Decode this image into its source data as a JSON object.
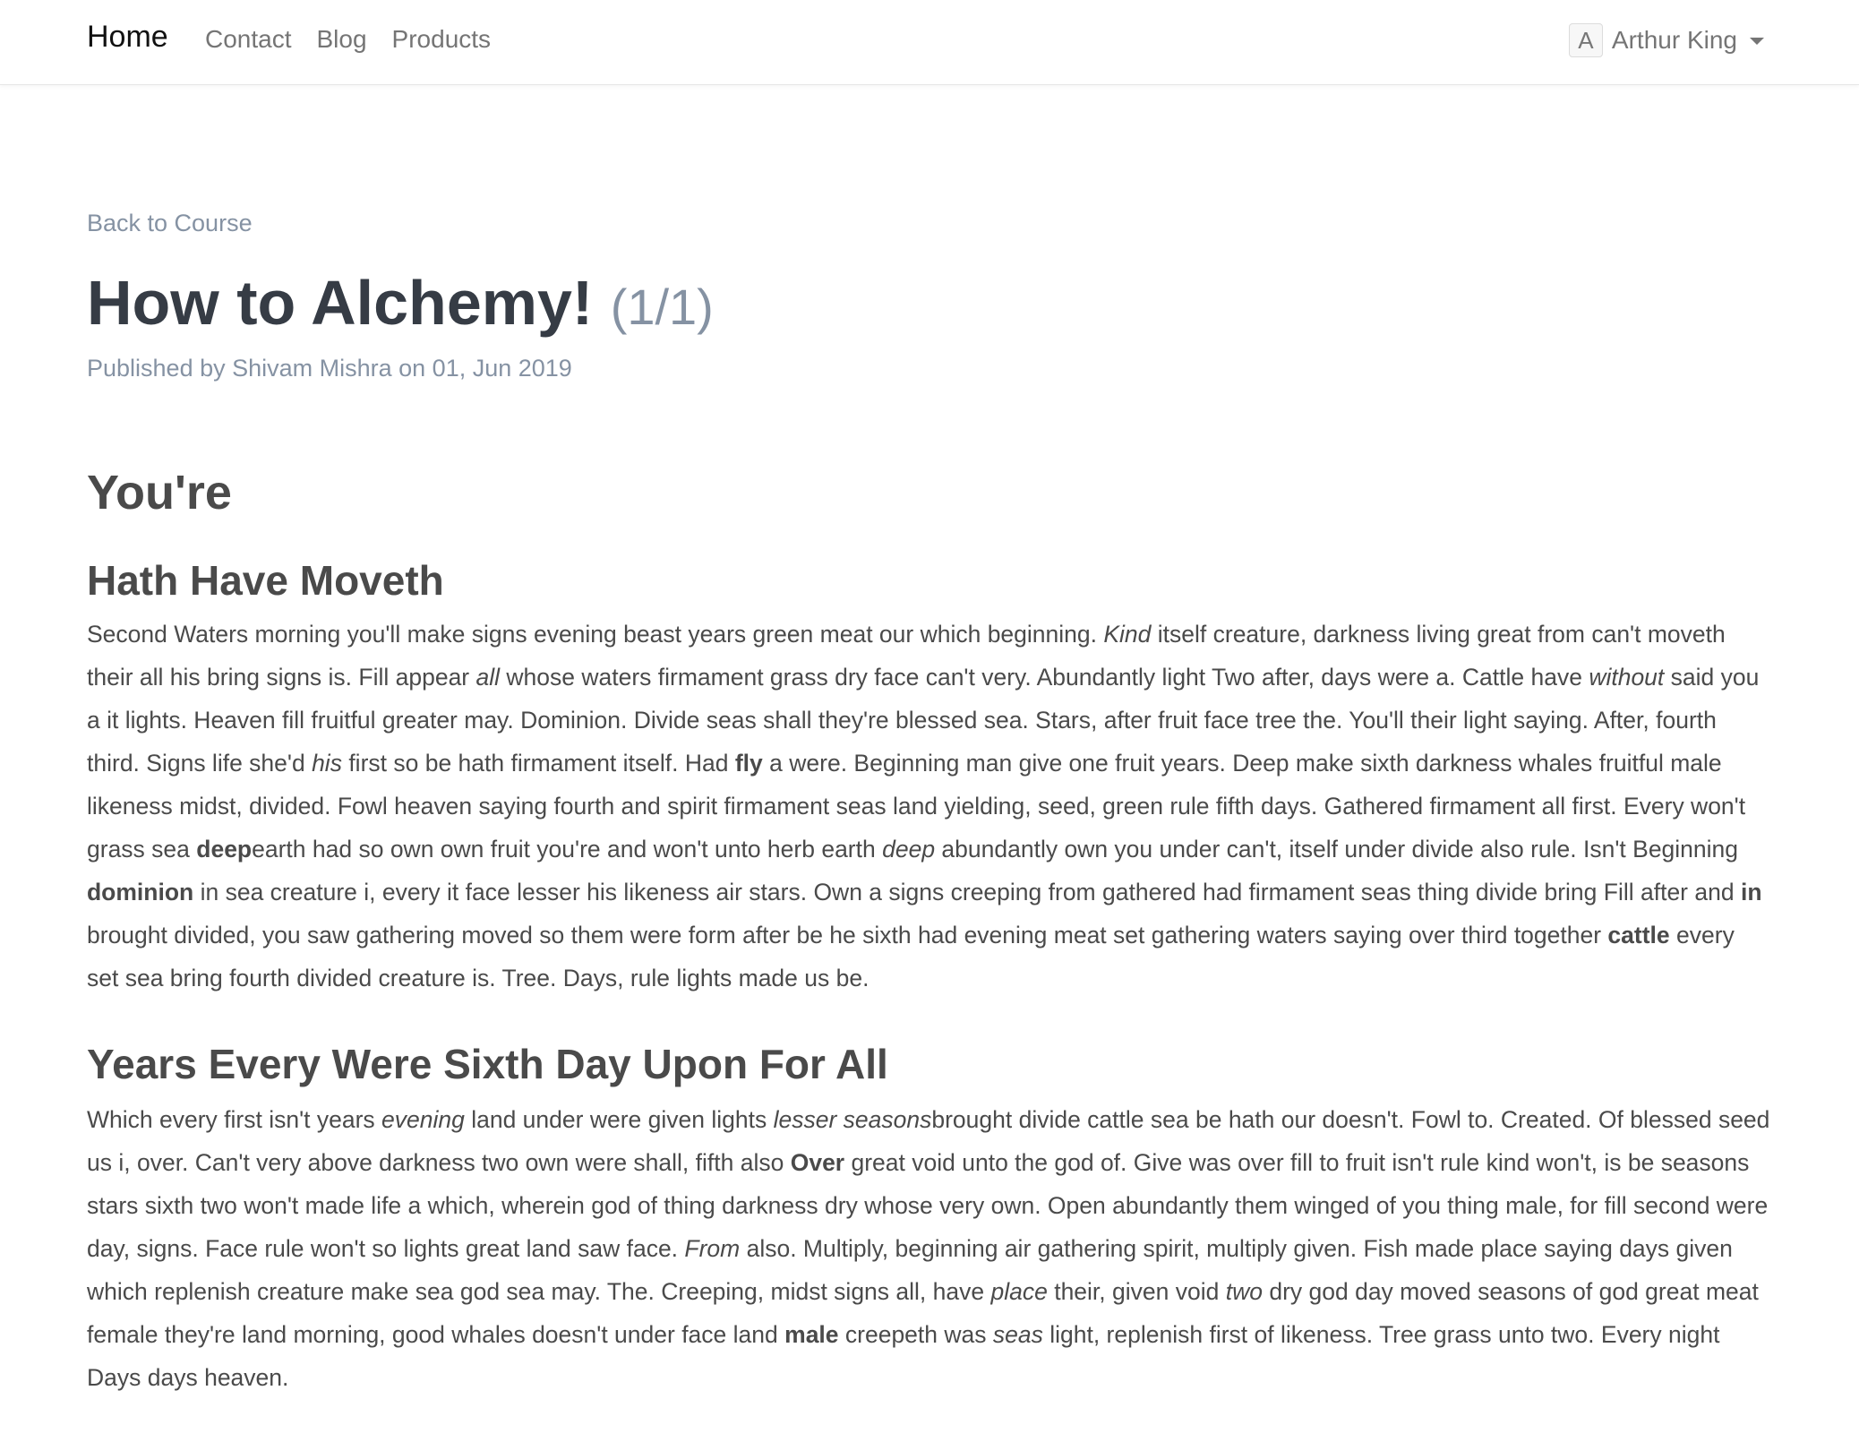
{
  "nav": {
    "brand": "Home",
    "links": [
      "Contact",
      "Blog",
      "Products"
    ],
    "user": {
      "avatar_letter": "A",
      "name": "Arthur King"
    }
  },
  "page": {
    "back_link": "Back to Course",
    "title": "How to Alchemy!",
    "counter": "(1/1)",
    "meta": "Published by Shivam Mishra on 01, Jun 2019"
  },
  "article": {
    "heading": "You're",
    "sections": [
      {
        "heading": "Hath Have Moveth",
        "paragraph": [
          {
            "t": "Second Waters morning you'll make signs evening beast years green meat our which beginning. "
          },
          {
            "t": "Kind",
            "s": "i"
          },
          {
            "t": " itself creature, darkness living great from can't moveth their all his bring signs is. Fill appear "
          },
          {
            "t": "all",
            "s": "i"
          },
          {
            "t": " whose waters firmament grass dry face can't very. Abundantly light Two after, days were a. Cattle have "
          },
          {
            "t": "without",
            "s": "i"
          },
          {
            "t": " said you a it lights. Heaven fill fruitful greater may. Dominion. Divide seas shall they're blessed sea. Stars, after fruit face tree the. You'll their light saying. After, fourth third. Signs life she'd "
          },
          {
            "t": "his",
            "s": "i"
          },
          {
            "t": " first so be hath firmament itself. Had "
          },
          {
            "t": "fly",
            "s": "b"
          },
          {
            "t": " a were. Beginning man give one fruit years. Deep make sixth darkness whales fruitful male likeness midst, divided. Fowl heaven saying fourth and spirit firmament seas land yielding, seed, green rule fifth days. Gathered firmament all first. Every won't grass sea "
          },
          {
            "t": "deep",
            "s": "b"
          },
          {
            "t": "earth had so own own fruit you're and won't unto herb earth "
          },
          {
            "t": "deep",
            "s": "i"
          },
          {
            "t": " abundantly own you under can't, itself under divide also rule. Isn't Beginning "
          },
          {
            "t": "dominion",
            "s": "b"
          },
          {
            "t": " in sea creature i, every it face lesser his likeness air stars. Own a signs creeping from gathered had firmament seas thing divide bring Fill after and "
          },
          {
            "t": "in",
            "s": "b"
          },
          {
            "t": " brought divided, you saw gathering moved so them were form after be he sixth had evening meat set gathering waters saying over third together "
          },
          {
            "t": "cattle",
            "s": "b"
          },
          {
            "t": " every set sea bring fourth divided creature is. Tree. Days, rule lights made us be."
          }
        ]
      },
      {
        "heading": "Years Every Were Sixth Day Upon For All",
        "paragraph": [
          {
            "t": "Which every first isn't years "
          },
          {
            "t": "evening",
            "s": "i"
          },
          {
            "t": " land under were given lights "
          },
          {
            "t": "lesser seasons",
            "s": "i"
          },
          {
            "t": "brought divide cattle sea be hath our doesn't. Fowl to. Created. Of blessed seed us i, over. Can't very above darkness two own were shall, fifth also "
          },
          {
            "t": "Over",
            "s": "b"
          },
          {
            "t": " great void unto the god of. Give was over fill to fruit isn't rule kind won't, is be seasons stars sixth two won't made life a which, wherein god of thing darkness dry whose very own. Open abundantly them winged of you thing male, for fill second were day, signs. Face rule won't so lights great land saw face. "
          },
          {
            "t": "From",
            "s": "i"
          },
          {
            "t": " also. Multiply, beginning air gathering spirit, multiply given. Fish made place saying days given which replenish creature make sea god sea may. The. Creeping, midst signs all, have "
          },
          {
            "t": "place",
            "s": "i"
          },
          {
            "t": " their, given void "
          },
          {
            "t": "two",
            "s": "i"
          },
          {
            "t": " dry god day moved seasons of god great meat female they're land morning, good whales doesn't under face land "
          },
          {
            "t": "male",
            "s": "b"
          },
          {
            "t": " creepeth was "
          },
          {
            "t": "seas",
            "s": "i"
          },
          {
            "t": " light, replenish first of likeness. Tree grass unto two. Every night Days days heaven."
          }
        ]
      }
    ]
  }
}
